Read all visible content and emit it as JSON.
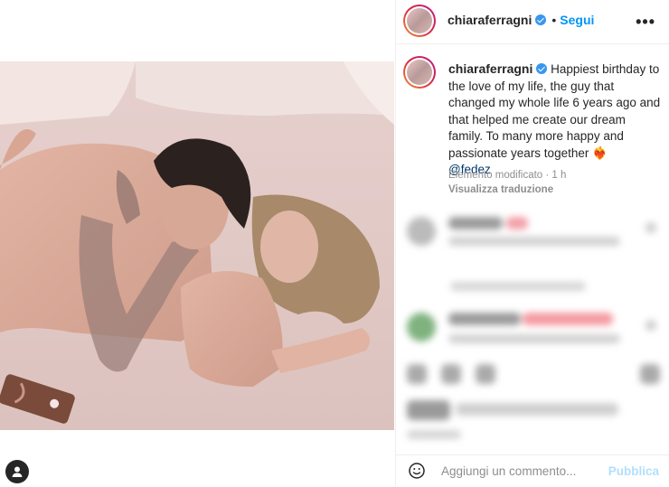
{
  "post": {
    "username": "chiaraferragni",
    "separator": "•",
    "follow_label": "Segui",
    "more_label": "•••"
  },
  "caption": {
    "username": "chiaraferragni",
    "text": "Happiest birthday to the love of my life, the guy that changed my whole life 6 years ago and that helped me create our dream family. To many more happy and passionate years together",
    "emoji": "❤️‍🔥",
    "mention": "@fedez",
    "meta": "Elemento modificato · 1 h",
    "translate_label": "Visualizza traduzione"
  },
  "comment_box": {
    "placeholder": "Aggiungi un commento...",
    "publish_label": "Pubblica"
  },
  "colors": {
    "follow": "#0095f6",
    "verified": "#3897f0",
    "publish_disabled": "#b2dffc",
    "heart": "#ed4956"
  },
  "icons": {
    "verified": "verified-badge-icon",
    "user_tag": "user-tag-icon",
    "emoji": "emoji-smile-icon",
    "more": "more-options-icon"
  }
}
